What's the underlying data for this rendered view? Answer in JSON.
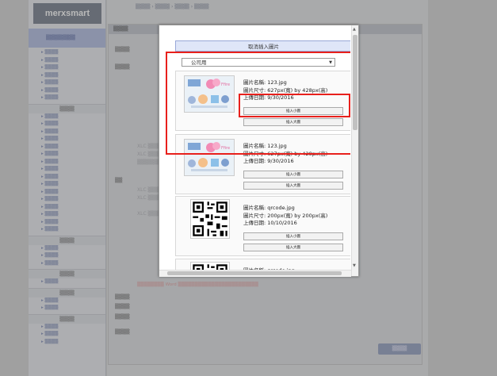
{
  "sidebar": {
    "logo": "merxsmart",
    "user": "▒▒▒▒▒▒▒▒",
    "groups": [
      {
        "head": "",
        "items": [
          "▒▒▒▒",
          "▒▒▒▒",
          "▒▒▒▒",
          "▒▒▒▒",
          "▒▒▒▒",
          "▒▒▒▒",
          "▒▒▒▒"
        ]
      },
      {
        "head": "▒▒▒▒",
        "items": [
          "▒▒▒▒",
          "▒▒▒▒",
          "▒▒▒▒",
          "▒▒▒▒",
          "▒▒▒▒",
          "▒▒▒▒",
          "▒▒▒▒",
          "▒▒▒▒",
          "▒▒▒▒",
          "▒▒▒▒",
          "▒▒▒▒",
          "▒▒▒▒",
          "▒▒▒▒",
          "▒▒▒▒",
          "▒▒▒▒",
          "▒▒▒▒"
        ]
      },
      {
        "head": "▒▒▒▒",
        "items": [
          "▒▒▒▒",
          "▒▒▒▒",
          "▒▒▒▒"
        ]
      },
      {
        "head": "▒▒▒▒",
        "items": [
          "▒▒▒▒"
        ]
      },
      {
        "head": "▒▒▒▒",
        "items": [
          "▒▒▒▒",
          "▒▒▒▒"
        ]
      },
      {
        "head": "▒▒▒▒",
        "items": [
          "▒▒▒▒",
          "▒▒▒▒",
          "▒▒▒▒"
        ]
      }
    ]
  },
  "main": {
    "breadcrumb": "▒▒▒▒ › ▒▒▒▒ › ▒▒▒▒ › ▒▒▒▒",
    "panel_title": "▒▒▒▒",
    "row_labels": [
      "▒▒▒▒",
      "▒▒▒▒",
      "▒▒",
      "▒▒▒▒",
      "▒▒▒▒",
      "▒▒▒▒",
      "▒▒▒▒"
    ],
    "content_lines": [
      "XLC ▒▒▒▒▒▒▒▒▒▒▒▒▒▒▒▒▒▒▒▒▒▒▒▒▒▒",
      "XLC ▒▒▒▒▒▒▒▒ .com ▒▒▒▒▒▒▒▒▒▒▒▒▒",
      "▒▒▒▒▒▒▒▒▒▒▒▒▒▒▒▒▒▒▒▒▒▒▒▒",
      "XLC ▒▒▒▒▒▒▒▒▒▒▒▒▒▒▒▒▒▒▒▒▒▒▒▒▒▒",
      "XLC ▒▒▒▒▒▒▒▒▒▒▒▒▒▒▒▒▒▒▒▒▒▒▒▒▒▒",
      "XLC ▒▒▒▒▒▒▒▒▒▒▒▒▒▒▒▒▒▒▒▒▒▒▒▒▒▒"
    ],
    "note_red": "▒▒▒▒▒▒▒▒ Word ▒▒▒▒▒▒▒▒▒▒▒▒▒▒▒▒▒▒▒▒▒▒▒▒",
    "update_button": "▒▒▒▒"
  },
  "modal": {
    "cancel_label": "取消插入圖片",
    "album_selected": "公司用",
    "insert_small_label": "插入小圖",
    "insert_large_label": "插入大圖",
    "images": [
      {
        "name": "圖片名稱: 123.jpg",
        "size": "圖片尺寸: 627px(寬) by 428px(高)",
        "date": "上傳日期: 9/30/2016",
        "thumb": "app-banner"
      },
      {
        "name": "圖片名稱: 123.jpg",
        "size": "圖片尺寸: 627px(寬) by 428px(高)",
        "date": "上傳日期: 9/30/2016",
        "thumb": "app-banner"
      },
      {
        "name": "圖片名稱: qrcode.jpg",
        "size": "圖片尺寸: 200px(寬) by 200px(高)",
        "date": "上傳日期: 10/10/2016",
        "thumb": "qr-code"
      },
      {
        "name": "圖片名稱: qrcode.jpg",
        "size": "",
        "date": "",
        "thumb": "qr-code"
      }
    ]
  },
  "colors": {
    "highlight": "#e8201c",
    "cancel_bg": "#dfe6f8",
    "overlay": "#3c3c3c"
  }
}
